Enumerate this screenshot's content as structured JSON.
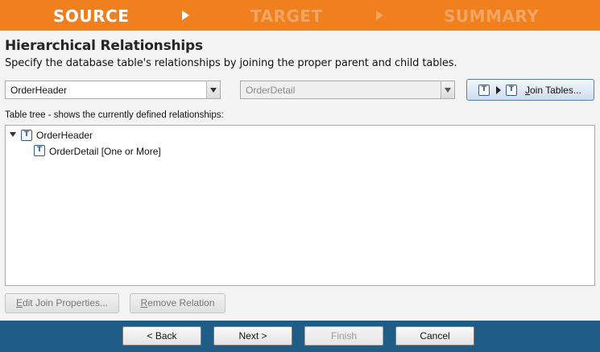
{
  "steps": [
    {
      "label": "SOURCE",
      "active": true
    },
    {
      "label": "TARGET",
      "active": false
    },
    {
      "label": "SUMMARY",
      "active": false
    }
  ],
  "heading": "Hierarchical Relationships",
  "description": "Specify the database table's relationships by joining the proper parent and child tables.",
  "parent_combo": {
    "value": "OrderHeader"
  },
  "child_combo": {
    "value": "OrderDetail",
    "disabled": true
  },
  "join_button": {
    "label": "Join Tables...",
    "mnemonic": "J",
    "rest": "oin Tables..."
  },
  "tree_label": "Table tree - shows the currently defined relationships:",
  "tree": [
    {
      "label": "OrderHeader",
      "expanded": true
    },
    {
      "label": "OrderDetail [One or More]"
    }
  ],
  "actions": {
    "edit_join": {
      "mnemonic": "E",
      "rest": "dit Join Properties..."
    },
    "remove_relation": {
      "mnemonic": "R",
      "rest": "emove Relation"
    }
  },
  "nav": {
    "back": "< Back",
    "next": "Next >",
    "finish": "Finish",
    "cancel": "Cancel"
  },
  "colors": {
    "stepbar": "#f07f1d",
    "footer": "#1f5c86"
  }
}
